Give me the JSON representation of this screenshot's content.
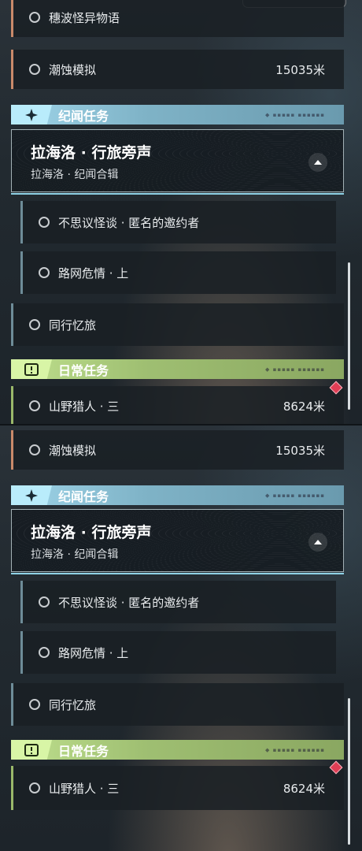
{
  "top": {
    "row_spectral": {
      "label": "穗波怪异物语"
    },
    "row_tidal": {
      "label": "潮蚀模拟",
      "distance": "15035米"
    },
    "section_chronicle": {
      "title": "纪闻任务",
      "icon": "four-point-star-icon"
    },
    "card": {
      "title": "拉海洛 · 行旅旁声",
      "subtitle": "拉海洛 · 纪闻合辑"
    },
    "sub1": {
      "label": "不思议怪谈 · 匿名的邀约者"
    },
    "sub2": {
      "label": "路网危情 · 上"
    },
    "row_companion": {
      "label": "同行忆旅"
    },
    "section_daily": {
      "title": "日常任务",
      "icon": "exclamation-box-icon"
    },
    "row_hunter": {
      "label": "山野猎人 · 三",
      "distance": "8624米"
    }
  },
  "bottom": {
    "row_tidal": {
      "label": "潮蚀模拟",
      "distance": "15035米"
    },
    "section_chronicle": {
      "title": "纪闻任务",
      "icon": "four-point-star-icon"
    },
    "card": {
      "title": "拉海洛 · 行旅旁声",
      "subtitle": "拉海洛 · 纪闻合辑"
    },
    "sub1": {
      "label": "不思议怪谈 · 匿名的邀约者"
    },
    "sub2": {
      "label": "路网危情 · 上"
    },
    "row_companion": {
      "label": "同行忆旅"
    },
    "section_daily": {
      "title": "日常任务",
      "icon": "exclamation-box-icon"
    },
    "row_hunter": {
      "label": "山野猎人 · 三",
      "distance": "8624米"
    }
  },
  "colors": {
    "chronicle_accent": "#9fd5e9",
    "daily_accent": "#bfe08e",
    "main_quest_bar": "#c98a6a",
    "marker": "#e03e55"
  }
}
